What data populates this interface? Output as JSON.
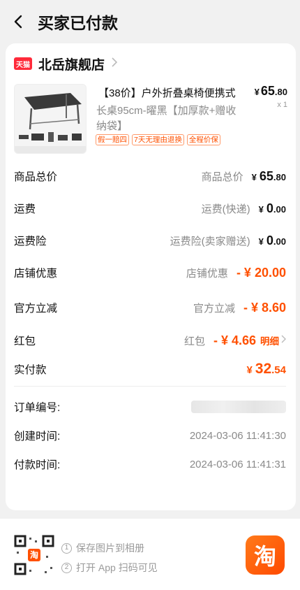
{
  "header": {
    "title": "买家已付款",
    "back_icon": "chevron-left-icon"
  },
  "shop": {
    "badge": "天猫",
    "name": "北岳旗舰店",
    "arrow_icon": "chevron-right-icon"
  },
  "product": {
    "title": "【38价】户外折叠桌椅便携式",
    "sku": "长桌95cm-曜黑【加厚款+赠收纳袋】",
    "price": {
      "currency": "¥",
      "int": "65",
      "dec": ".80"
    },
    "qty": "x 1",
    "tags": [
      "假一赔四",
      "7天无理由退换",
      "全程价保"
    ]
  },
  "rows": {
    "total": {
      "label": "商品总价",
      "sub": "商品总价",
      "cur": "¥",
      "int": "65",
      "dec": ".80"
    },
    "shipping": {
      "label": "运费",
      "sub": "运费(快递)",
      "cur": "¥",
      "int": "0",
      "dec": ".00"
    },
    "insurance": {
      "label": "运费险",
      "sub": "运费险(卖家赠送)",
      "cur": "¥",
      "int": "0",
      "dec": ".00"
    },
    "shop_discount": {
      "label": "店铺优惠",
      "sub": "店铺优惠",
      "amount": "- ¥ 20.00"
    },
    "official_discount": {
      "label": "官方立减",
      "sub": "官方立减",
      "amount": "- ¥ 8.60"
    },
    "red_packet": {
      "label": "红包",
      "sub": "红包",
      "amount": "- ¥ 4.66",
      "link": "明细"
    },
    "paid": {
      "label": "实付款",
      "cur": "¥",
      "int": "32",
      "dec": ".54"
    }
  },
  "info": {
    "order_label": "订单编号:",
    "created_label": "创建时间:",
    "created_value": "2024-03-06 11:41:30",
    "paid_label": "付款时间:",
    "paid_value": "2024-03-06 11:41:31"
  },
  "footer": {
    "step1": "保存图片到相册",
    "step2": "打开 App 扫码可见",
    "step1_num": "1",
    "step2_num": "2",
    "app_icon": "淘"
  },
  "colors": {
    "accent": "#ff5000",
    "tmall": "#ff2a3a"
  }
}
